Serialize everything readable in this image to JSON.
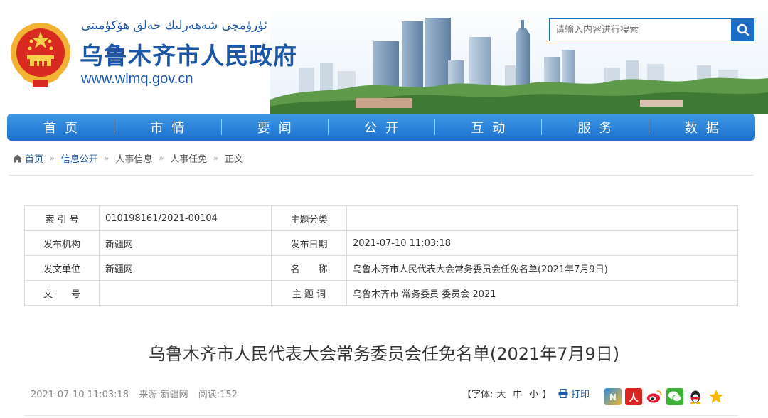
{
  "header": {
    "uyghur_title": "ئۈرۈمچى شەھەرلىك خەلق ھۆكۈمىتى",
    "site_title": "乌鲁木齐市人民政府",
    "site_url": "www.wlmq.gov.cn",
    "search_placeholder": "请输入内容进行搜索"
  },
  "nav": {
    "items": [
      "首页",
      "市情",
      "要闻",
      "公开",
      "互动",
      "服务",
      "数据"
    ]
  },
  "breadcrumb": {
    "items": [
      "首页",
      "信息公开",
      "人事信息",
      "人事任免",
      "正文"
    ]
  },
  "meta_table": {
    "rows": [
      {
        "label1": "索 引 号",
        "value1": "010198161/2021-00104",
        "label2": "主题分类",
        "value2": ""
      },
      {
        "label1": "发布机构",
        "value1": "新疆网",
        "label2": "发布日期",
        "value2": "2021-07-10 11:03:18"
      },
      {
        "label1": "发文单位",
        "value1": "新疆网",
        "label2": "名　　称",
        "value2": "乌鲁木齐市人民代表大会常务委员会任免名单(2021年7月9日)"
      },
      {
        "label1": "文　　号",
        "value1": "",
        "label2": "主 题 词",
        "value2": "乌鲁木齐市 常务委员 委员会 2021"
      }
    ]
  },
  "article": {
    "title": "乌鲁木齐市人民代表大会常务委员会任免名单(2021年7月9日)",
    "date": "2021-07-10 11:03:18",
    "source": "来源:新疆网",
    "views": "阅读:152",
    "font_size_prefix": "【字体:",
    "font_size_options": [
      "大",
      "中",
      "小"
    ],
    "font_size_suffix": "】",
    "print_label": "打印"
  },
  "share_icons": [
    "netease-icon",
    "renren-icon",
    "weibo-icon",
    "wechat-icon",
    "qq-icon",
    "qzone-icon"
  ],
  "colors": {
    "brand_blue": "#1c56a7",
    "nav_blue": "#2a80da"
  }
}
